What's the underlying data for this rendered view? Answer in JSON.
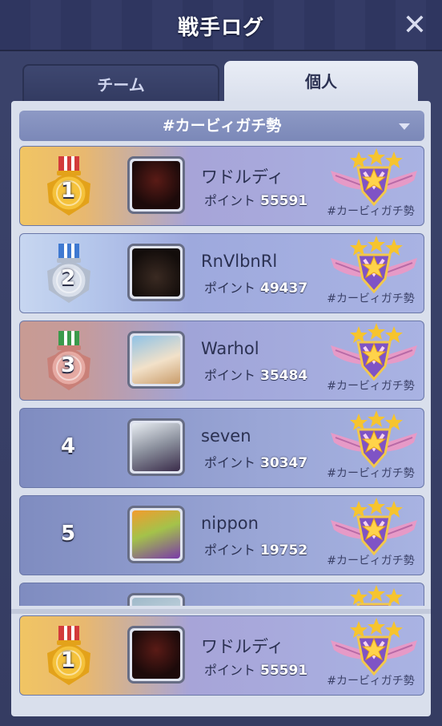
{
  "header": {
    "title": "戦手ログ",
    "close_icon": "close-icon"
  },
  "tabs": [
    {
      "label": "チーム",
      "active": false
    },
    {
      "label": "個人",
      "active": true
    }
  ],
  "filter": {
    "selected": "#カービィガチ勢"
  },
  "rankings": [
    {
      "rank": "1",
      "name": "ワドルディ",
      "points_label": "ポイント",
      "points": "55591",
      "badge_label": "#カービィガチ勢",
      "medal": "gold"
    },
    {
      "rank": "2",
      "name": "RnVlbnRl",
      "points_label": "ポイント",
      "points": "49437",
      "badge_label": "#カービィガチ勢",
      "medal": "silver"
    },
    {
      "rank": "3",
      "name": "Warhol",
      "points_label": "ポイント",
      "points": "35484",
      "badge_label": "#カービィガチ勢",
      "medal": "bronze"
    },
    {
      "rank": "4",
      "name": "seven",
      "points_label": "ポイント",
      "points": "30347",
      "badge_label": "#カービィガチ勢",
      "medal": "none"
    },
    {
      "rank": "5",
      "name": "nippon",
      "points_label": "ポイント",
      "points": "19752",
      "badge_label": "#カービィガチ勢",
      "medal": "none"
    }
  ],
  "self": {
    "rank": "1",
    "name": "ワドルディ",
    "points_label": "ポイント",
    "points": "55591",
    "badge_label": "#カービィガチ勢",
    "medal": "gold"
  },
  "colors": {
    "gold": "#e8b12e",
    "silver": "#c3cad8",
    "bronze": "#d99890",
    "accent": "#7b88b8"
  }
}
